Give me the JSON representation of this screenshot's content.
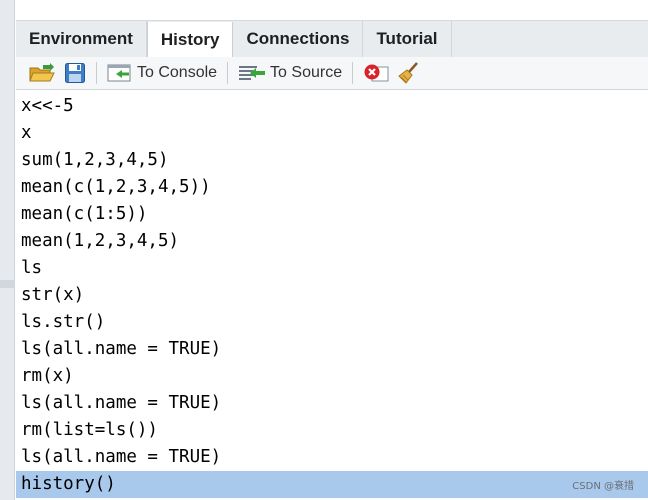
{
  "tabs": [
    {
      "label": "Environment"
    },
    {
      "label": "History"
    },
    {
      "label": "Connections"
    },
    {
      "label": "Tutorial"
    }
  ],
  "active_tab": "History",
  "toolbar": {
    "open_icon": "open-folder-icon",
    "save_icon": "save-disk-icon",
    "to_console_label": "To Console",
    "to_source_label": "To Source",
    "remove_icon": "remove-entry-icon",
    "clear_icon": "broom-icon"
  },
  "history": {
    "lines": [
      "x<<-5",
      "x",
      "sum(1,2,3,4,5)",
      "mean(c(1,2,3,4,5))",
      "mean(c(1:5))",
      "mean(1,2,3,4,5)",
      "ls",
      "str(x)",
      "ls.str()",
      "ls(all.name = TRUE)",
      "rm(x)",
      "ls(all.name = TRUE)",
      "rm(list=ls())",
      "ls(all.name = TRUE)",
      "history()"
    ],
    "selected_index": 14
  },
  "watermark": "CSDN @衰措",
  "colors": {
    "selection": "#a8c8ec",
    "tabbar_bg": "#e9ecef",
    "toolbar_bg": "#f6f7f9"
  }
}
